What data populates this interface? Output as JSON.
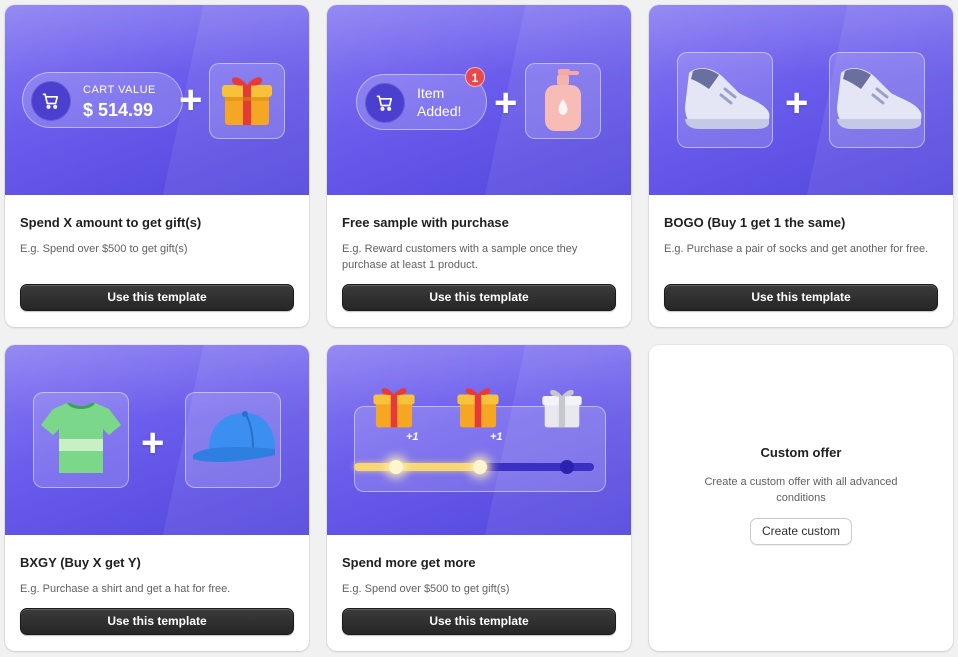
{
  "colors": {
    "banner_top": "#8a7df2",
    "banner_bottom": "#5145dc",
    "primary_button": "#303030",
    "badge": "#e5484d",
    "progress_fill": "#f6d675"
  },
  "cards": [
    {
      "title": "Spend X amount to get gift(s)",
      "description": "E.g. Spend over $500 to get gift(s)",
      "button_label": "Use this template",
      "illustration": {
        "cart_label": "CART VALUE",
        "cart_value": "$ 514.99",
        "icons": [
          "cart-icon",
          "plus-icon",
          "gift-icon"
        ]
      }
    },
    {
      "title": "Free sample with purchase",
      "description": "E.g. Reward customers with a sample once they purchase at least 1 product.",
      "button_label": "Use this template",
      "illustration": {
        "pill_line1": "Item",
        "pill_line2": "Added!",
        "badge_count": "1",
        "icons": [
          "cart-icon",
          "plus-icon",
          "lotion-bottle-icon"
        ]
      }
    },
    {
      "title": "BOGO (Buy 1 get 1 the same)",
      "description": "E.g. Purchase a pair of socks and get another for free.",
      "button_label": "Use this template",
      "illustration": {
        "icons": [
          "sneaker-icon",
          "plus-icon",
          "sneaker-icon"
        ]
      }
    },
    {
      "title": "BXGY (Buy X get Y)",
      "description": "E.g. Purchase a shirt and get a hat for free.",
      "button_label": "Use this template",
      "illustration": {
        "icons": [
          "tshirt-icon",
          "plus-icon",
          "cap-icon"
        ]
      }
    },
    {
      "title": "Spend more get more",
      "description": "E.g. Spend over $500 to get gift(s)",
      "button_label": "Use this template",
      "illustration": {
        "milestone_1": "+1",
        "milestone_2": "+1",
        "progress_fraction": 0.55,
        "icons": [
          "gift-icon",
          "gift-icon",
          "gift-locked-icon"
        ]
      }
    }
  ],
  "custom": {
    "title": "Custom offer",
    "description": "Create a custom offer with all advanced conditions",
    "button_label": "Create custom"
  }
}
